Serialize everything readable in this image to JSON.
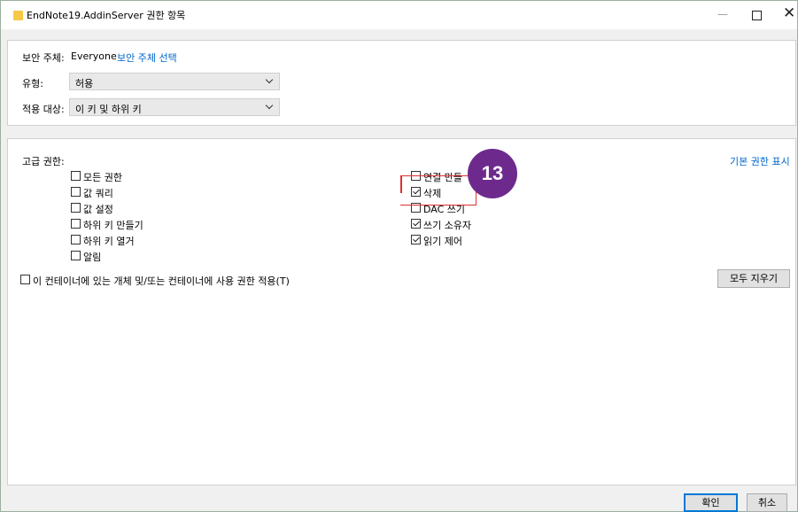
{
  "window": {
    "title": "EndNote19.AddinServer 권한 항목",
    "controls": {
      "minimize": "—",
      "maximize": "",
      "close": "✕"
    }
  },
  "principal": {
    "label": "보안 주체:",
    "value": "Everyone",
    "select_link": "보안 주체 선택"
  },
  "type": {
    "label": "유형:",
    "value": "허용"
  },
  "applies_to": {
    "label": "적용 대상:",
    "value": "이 키 및 하위 키"
  },
  "advanced": {
    "label": "고급 권한:",
    "show_basic_link": "기본 권한 표시",
    "left_column": [
      {
        "label": "모든 권한",
        "checked": false
      },
      {
        "label": "값 쿼리",
        "checked": false
      },
      {
        "label": "값 설정",
        "checked": false
      },
      {
        "label": "하위 키 만들기",
        "checked": false
      },
      {
        "label": "하위 키 열거",
        "checked": false
      },
      {
        "label": "알림",
        "checked": false
      }
    ],
    "right_column": [
      {
        "label": "연결 만들",
        "checked": false
      },
      {
        "label": "삭제",
        "checked": true
      },
      {
        "label": "DAC 쓰기",
        "checked": false
      },
      {
        "label": "쓰기 소유자",
        "checked": true
      },
      {
        "label": "읽기 제어",
        "checked": true
      }
    ]
  },
  "inherit_checkbox": {
    "label": "이 컨테이너에 있는 개체 및/또는 컨테이너에 사용 권한 적용(T)",
    "checked": false
  },
  "clear_all_button": "모두 지우기",
  "footer": {
    "ok": "확인",
    "cancel": "취소"
  },
  "annotation": {
    "step_number": "13",
    "badge_color": "#6d2a8c",
    "highlight_color": "#e03030"
  },
  "colors": {
    "link": "#0066cc",
    "primary_border": "#0078d7"
  }
}
